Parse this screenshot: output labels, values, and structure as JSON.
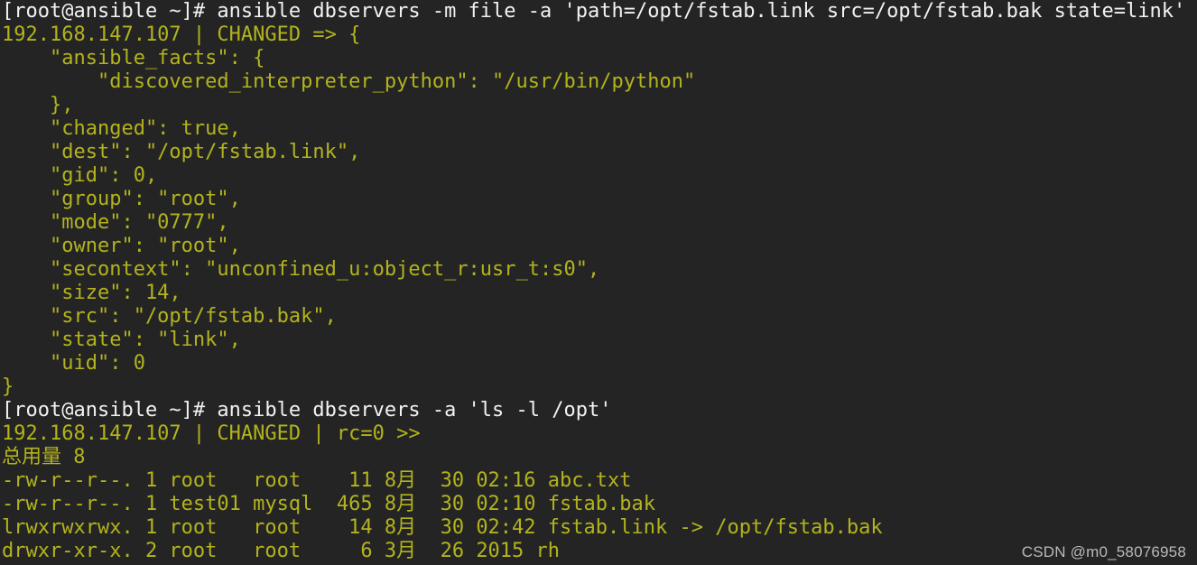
{
  "terminal": {
    "background_color": "#242424",
    "prompt_color": "#f2f2f2",
    "output_color": "#b3b31e",
    "watermark_color": "#b9b9b9",
    "watermark": "CSDN @m0_58076958",
    "lines": [
      {
        "kind": "prompt",
        "text": "[root@ansible ~]# ansible dbservers -m file -a 'path=/opt/fstab.link src=/opt/fstab.bak state=link'"
      },
      {
        "kind": "output",
        "text": "192.168.147.107 | CHANGED => {"
      },
      {
        "kind": "output",
        "text": "    \"ansible_facts\": {"
      },
      {
        "kind": "output",
        "text": "        \"discovered_interpreter_python\": \"/usr/bin/python\""
      },
      {
        "kind": "output",
        "text": "    },"
      },
      {
        "kind": "output",
        "text": "    \"changed\": true,"
      },
      {
        "kind": "output",
        "text": "    \"dest\": \"/opt/fstab.link\","
      },
      {
        "kind": "output",
        "text": "    \"gid\": 0,"
      },
      {
        "kind": "output",
        "text": "    \"group\": \"root\","
      },
      {
        "kind": "output",
        "text": "    \"mode\": \"0777\","
      },
      {
        "kind": "output",
        "text": "    \"owner\": \"root\","
      },
      {
        "kind": "output",
        "text": "    \"secontext\": \"unconfined_u:object_r:usr_t:s0\","
      },
      {
        "kind": "output",
        "text": "    \"size\": 14,"
      },
      {
        "kind": "output",
        "text": "    \"src\": \"/opt/fstab.bak\","
      },
      {
        "kind": "output",
        "text": "    \"state\": \"link\","
      },
      {
        "kind": "output",
        "text": "    \"uid\": 0"
      },
      {
        "kind": "output",
        "text": "}"
      },
      {
        "kind": "prompt",
        "text": "[root@ansible ~]# ansible dbservers -a 'ls -l /opt'"
      },
      {
        "kind": "output",
        "text": "192.168.147.107 | CHANGED | rc=0 >>"
      },
      {
        "kind": "output",
        "text": "总用量 8"
      },
      {
        "kind": "output",
        "text": "-rw-r--r--. 1 root   root    11 8月  30 02:16 abc.txt"
      },
      {
        "kind": "output",
        "text": "-rw-r--r--. 1 test01 mysql  465 8月  30 02:10 fstab.bak"
      },
      {
        "kind": "output",
        "text": "lrwxrwxrwx. 1 root   root    14 8月  30 02:42 fstab.link -> /opt/fstab.bak"
      },
      {
        "kind": "output",
        "text": "drwxr-xr-x. 2 root   root     6 3月  26 2015 rh"
      }
    ]
  }
}
